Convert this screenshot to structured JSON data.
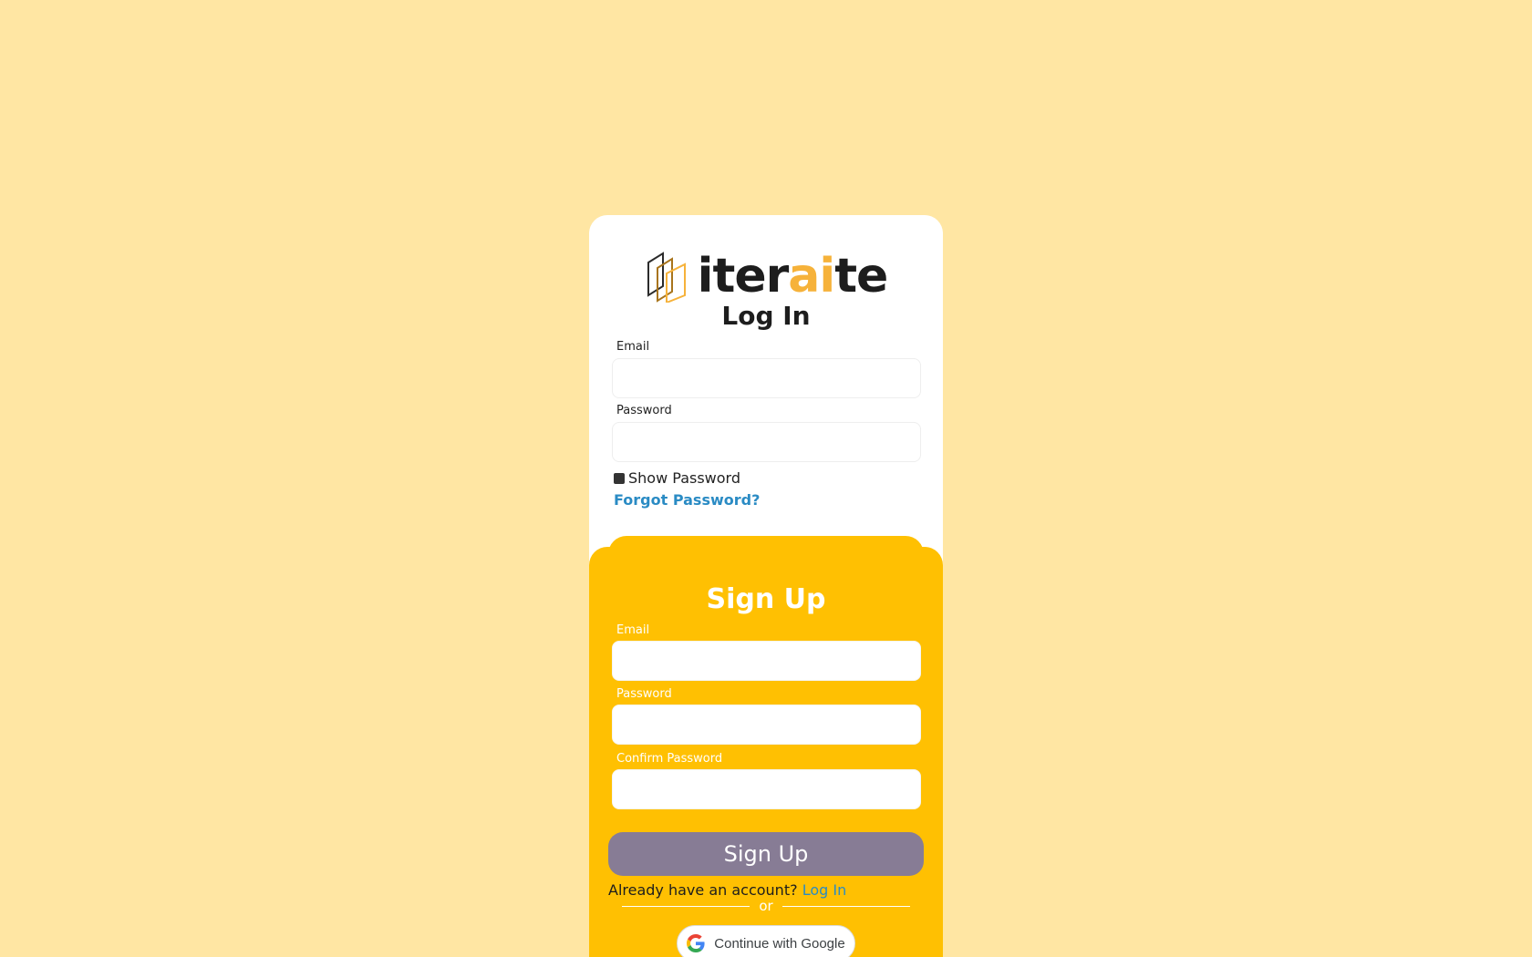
{
  "brand": {
    "name_part1": "iter",
    "name_accent": "ai",
    "name_part2": "te",
    "accent_color": "#F6B23A"
  },
  "login": {
    "title": "Log In",
    "email_label": "Email",
    "email_value": "",
    "password_label": "Password",
    "password_value": "",
    "show_password_label": "Show Password",
    "forgot_password_label": "Forgot Password?"
  },
  "signup": {
    "title": "Sign Up",
    "email_label": "Email",
    "email_value": "",
    "password_label": "Password",
    "password_value": "",
    "confirm_label": "Confirm Password",
    "confirm_value": "",
    "button_label": "Sign Up",
    "already_text": "Already have an account?",
    "login_link": "Log In",
    "or_text": "or",
    "google_label": "Continue with Google",
    "panel_color": "#FFC002",
    "button_color": "#877C95"
  },
  "icons": {
    "logo": "iteraite-logo-icon",
    "google": "google-icon",
    "checkbox": "checkbox-icon"
  },
  "colors": {
    "background": "#FFE6A3",
    "link": "#2a8bc4"
  }
}
